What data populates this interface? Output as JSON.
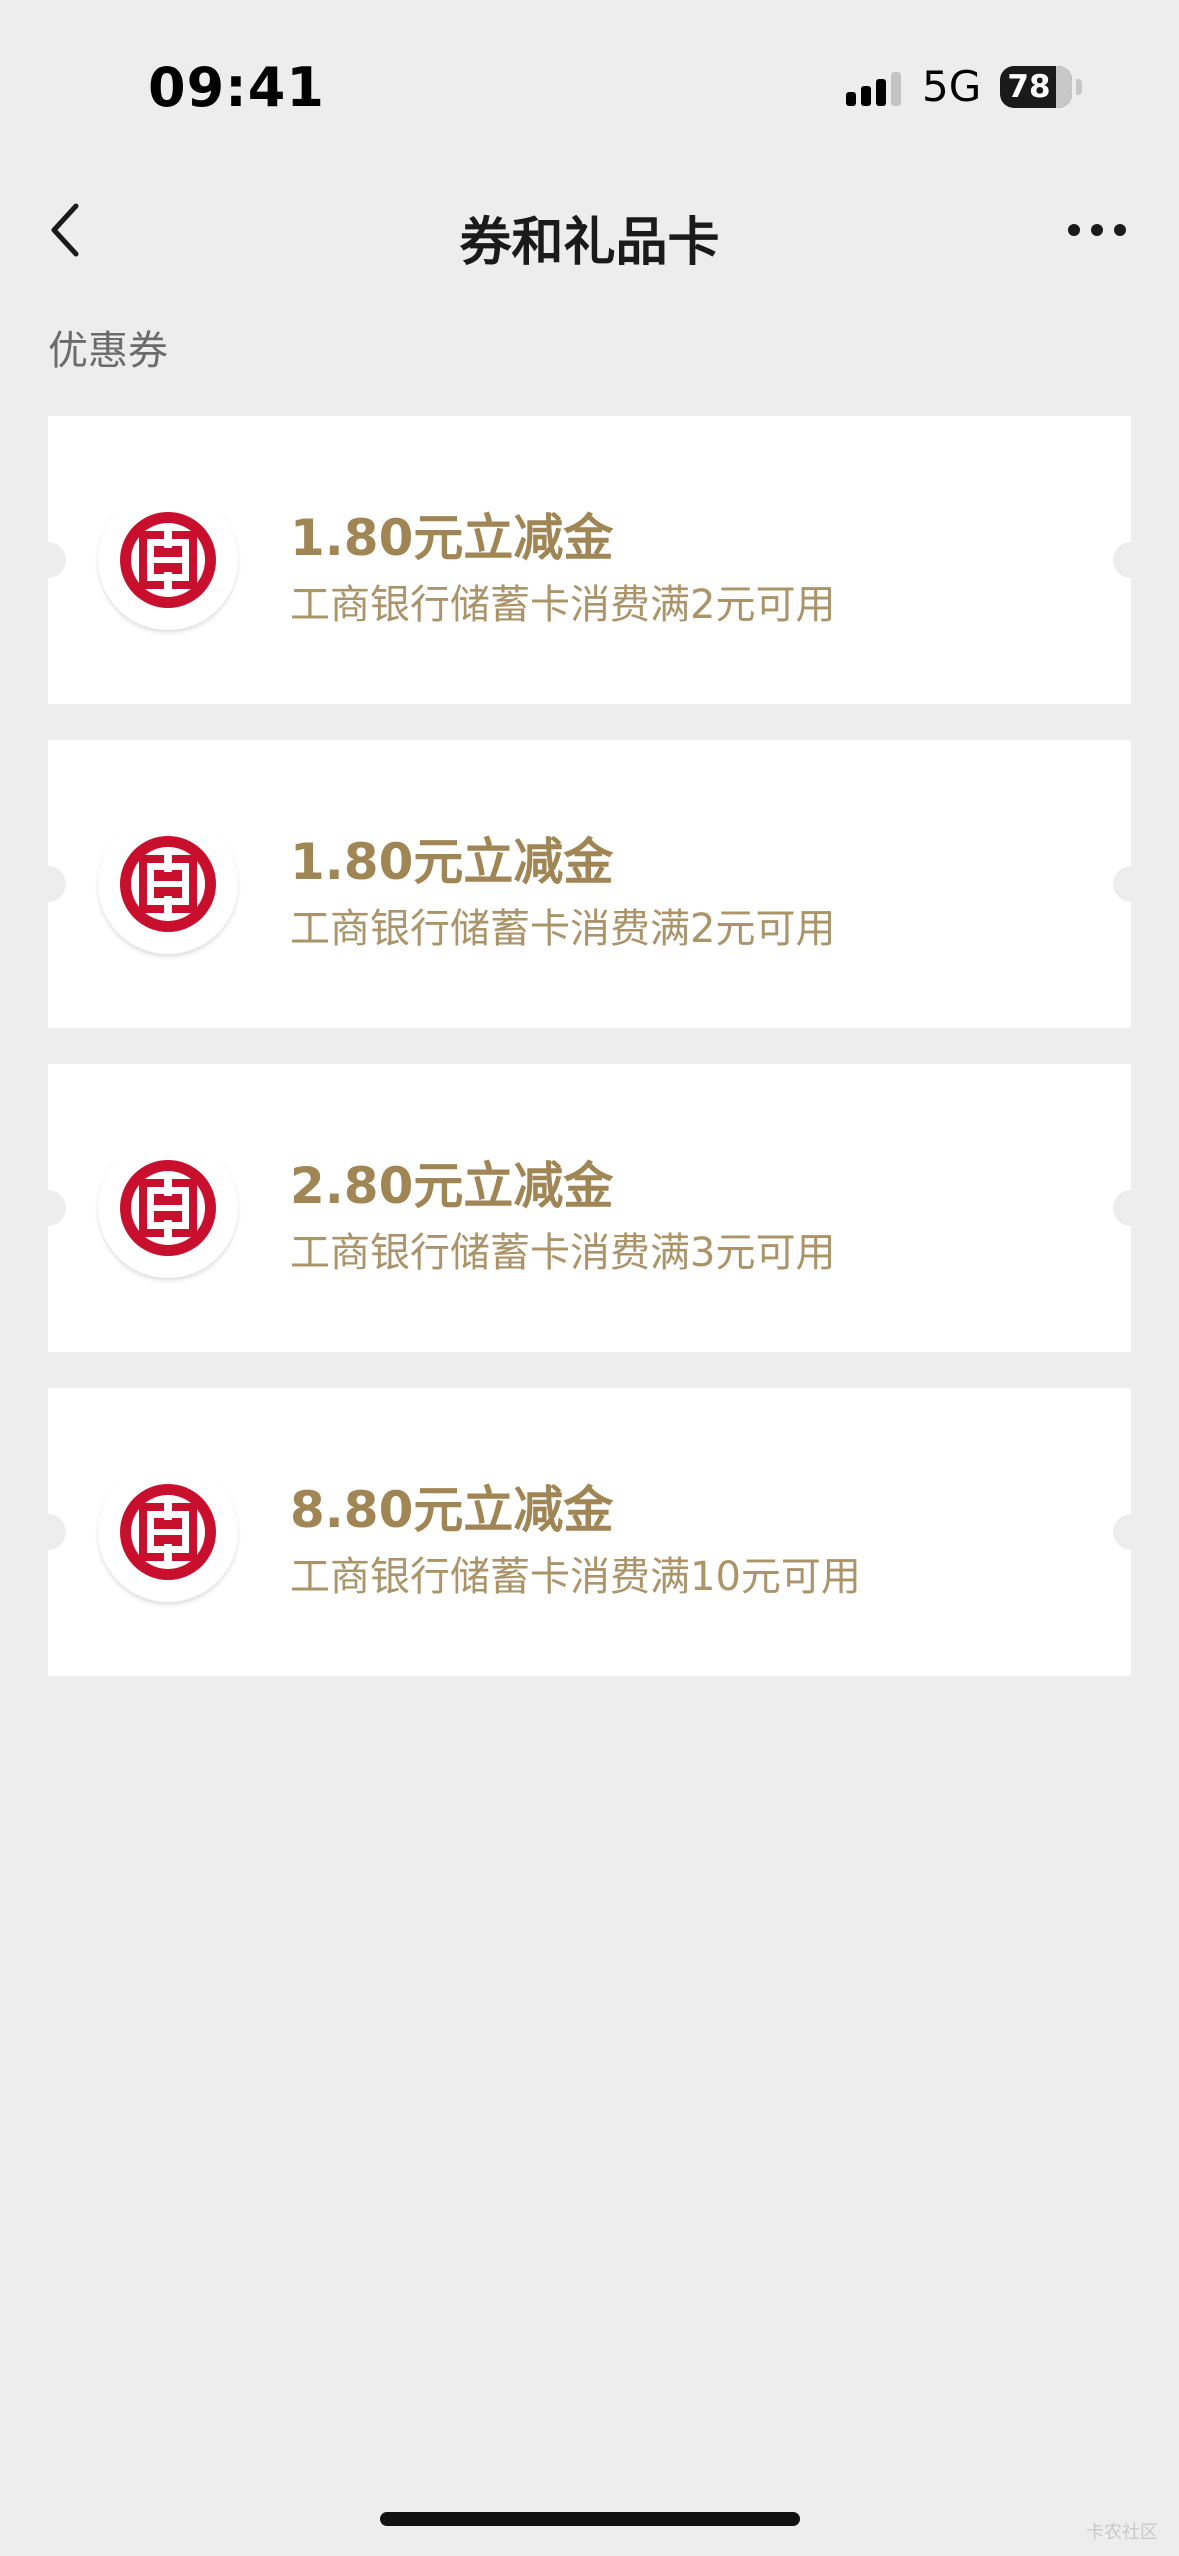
{
  "status_bar": {
    "time": "09:41",
    "network": "5G",
    "battery": "78"
  },
  "nav": {
    "title": "券和礼品卡"
  },
  "section": {
    "title": "优惠券"
  },
  "coupons": [
    {
      "title": "1.80元立减金",
      "desc": "工商银行储蓄卡消费满2元可用"
    },
    {
      "title": "1.80元立减金",
      "desc": "工商银行储蓄卡消费满2元可用"
    },
    {
      "title": "2.80元立减金",
      "desc": "工商银行储蓄卡消费满3元可用"
    },
    {
      "title": "8.80元立减金",
      "desc": "工商银行储蓄卡消费满10元可用"
    }
  ],
  "watermark": "卡农社区",
  "colors": {
    "background": "#ededed",
    "gold": "#a08655",
    "icbc_red": "#c8102e"
  }
}
